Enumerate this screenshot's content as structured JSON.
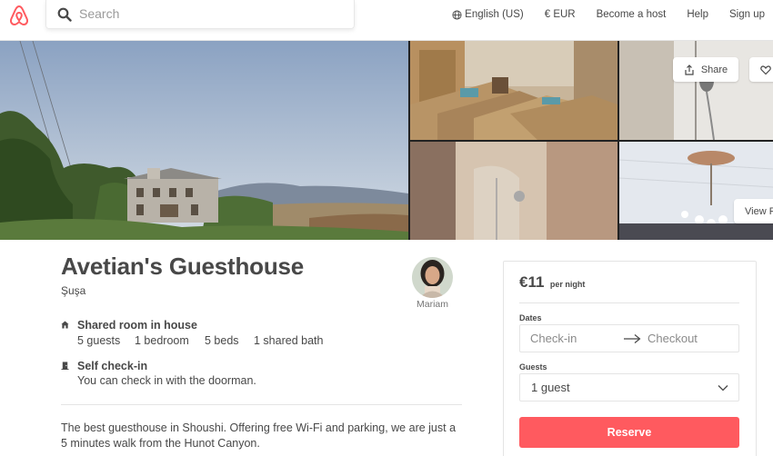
{
  "header": {
    "search_placeholder": "Search",
    "language": "English (US)",
    "currency": "€ EUR",
    "become_host": "Become a host",
    "help": "Help",
    "signup": "Sign up",
    "brand_color": "#ff5a5f"
  },
  "photos": {
    "share_label": "Share",
    "view_label": "View P"
  },
  "listing": {
    "title": "Avetian's Guesthouse",
    "location": "Şuşa",
    "host_name": "Mariam",
    "features": [
      {
        "icon": "home-icon",
        "title": "Shared room in house",
        "details": [
          "5 guests",
          "1 bedroom",
          "5 beds",
          "1 shared bath"
        ]
      },
      {
        "icon": "door-icon",
        "title": "Self check-in",
        "text": "You can check in with the doorman."
      }
    ],
    "description": "The best guesthouse in Shoushi. Offering free Wi-Fi and parking, we are just a 5 minutes walk from the Hunot Canyon."
  },
  "booking": {
    "price": "€11",
    "price_unit": "per night",
    "dates_label": "Dates",
    "checkin_placeholder": "Check-in",
    "checkout_placeholder": "Checkout",
    "guests_label": "Guests",
    "guests_value": "1 guest",
    "reserve_label": "Reserve",
    "reserve_color": "#ff5a5f"
  }
}
